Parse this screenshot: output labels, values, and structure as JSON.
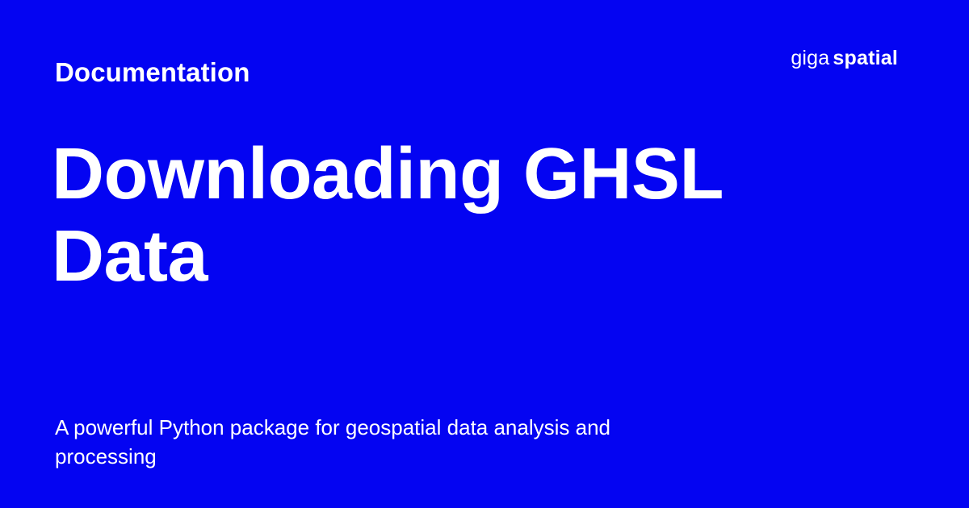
{
  "page": {
    "background_color": "#0404f2",
    "text_color": "#ffffff"
  },
  "header": {
    "section_label": "Documentation"
  },
  "logo": {
    "light_text": "giga",
    "bold_text": "spatial"
  },
  "main": {
    "title_lines": [
      "Downloading GHSL",
      "Data"
    ],
    "description": "A powerful Python package for geospatial data analysis and processing"
  }
}
